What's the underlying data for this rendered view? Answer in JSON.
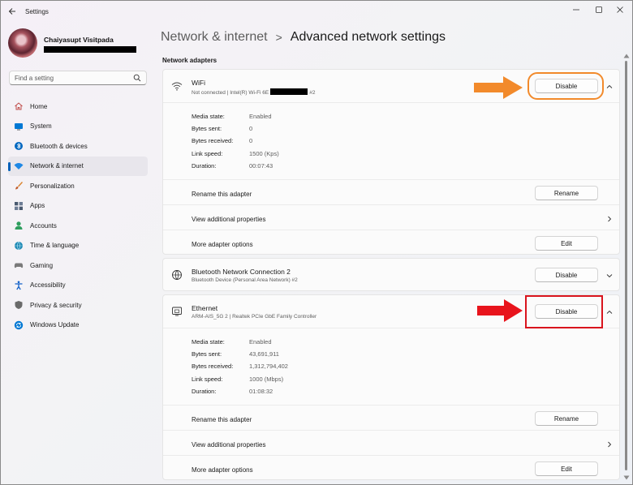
{
  "window": {
    "title": "Settings"
  },
  "profile": {
    "name": "Chaiyasupt Visitpada"
  },
  "search": {
    "placeholder": "Find a setting"
  },
  "nav": [
    {
      "label": "Home",
      "icon": "home-icon",
      "color": "#c0504d"
    },
    {
      "label": "System",
      "icon": "system-icon",
      "color": "#0078d4"
    },
    {
      "label": "Bluetooth & devices",
      "icon": "bluetooth-icon",
      "color": "#0067c0"
    },
    {
      "label": "Network & internet",
      "icon": "network-icon",
      "color": "#1e88e5",
      "active": true
    },
    {
      "label": "Personalization",
      "icon": "brush-icon",
      "color": "#d9822b"
    },
    {
      "label": "Apps",
      "icon": "apps-icon",
      "color": "#4a5a70"
    },
    {
      "label": "Accounts",
      "icon": "accounts-icon",
      "color": "#2e9e5e"
    },
    {
      "label": "Time & language",
      "icon": "globe-icon",
      "color": "#1f8ab5"
    },
    {
      "label": "Gaming",
      "icon": "gaming-icon",
      "color": "#7a7a7a"
    },
    {
      "label": "Accessibility",
      "icon": "accessibility-icon",
      "color": "#1260c8"
    },
    {
      "label": "Privacy & security",
      "icon": "shield-icon",
      "color": "#6a6a6a"
    },
    {
      "label": "Windows Update",
      "icon": "update-icon",
      "color": "#0078d4"
    }
  ],
  "header": {
    "parent": "Network & internet",
    "separator": ">",
    "current": "Advanced network settings",
    "section": "Network adapters"
  },
  "adapters": {
    "wifi": {
      "name": "WiFi",
      "desc_prefix": "Not connected | Intel(R) Wi-Fi 6E",
      "desc_suffix": "#2",
      "button": "Disable",
      "props": [
        {
          "label": "Media state:",
          "value": "Enabled"
        },
        {
          "label": "Bytes sent:",
          "value": "0"
        },
        {
          "label": "Bytes received:",
          "value": "0"
        },
        {
          "label": "Link speed:",
          "value": "1500 (Kps)"
        },
        {
          "label": "Duration:",
          "value": "00:07:43"
        }
      ],
      "rename_label": "Rename this adapter",
      "rename_button": "Rename",
      "view_label": "View additional properties",
      "options_label": "More adapter options",
      "edit_button": "Edit"
    },
    "bluetooth": {
      "name": "Bluetooth Network Connection 2",
      "desc": "Bluetooth Device (Personal Area Network) #2",
      "button": "Disable"
    },
    "ethernet": {
      "name": "Ethernet",
      "desc": "ARM-AIS_5G 2 | Realtek PCIe GbE Family Controller",
      "button": "Disable",
      "props": [
        {
          "label": "Media state:",
          "value": "Enabled"
        },
        {
          "label": "Bytes sent:",
          "value": "43,691,911"
        },
        {
          "label": "Bytes received:",
          "value": "1,312,794,402"
        },
        {
          "label": "Link speed:",
          "value": "1000 (Mbps)"
        },
        {
          "label": "Duration:",
          "value": "01:08:32"
        }
      ],
      "rename_label": "Rename this adapter",
      "rename_button": "Rename",
      "view_label": "View additional properties",
      "options_label": "More adapter options",
      "edit_button": "Edit"
    }
  },
  "annotations": {
    "orange": "#f28a2b",
    "red": "#d9141d"
  }
}
